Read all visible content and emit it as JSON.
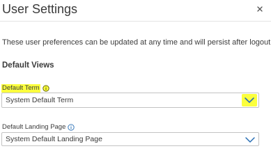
{
  "dialog": {
    "title": "User Settings",
    "close_icon": "close-icon",
    "description": "These user preferences can be updated at any time and will persist after logout."
  },
  "sections": {
    "default_views": {
      "heading": "Default Views",
      "default_term": {
        "label": "Default Term",
        "info_icon": "info-icon",
        "selected_value": "System Default Term",
        "highlighted": true,
        "highlight_color": "#fbff3d"
      },
      "default_landing_page": {
        "label": "Default Landing Page",
        "info_icon": "info-icon",
        "selected_value": "System Default Landing Page",
        "info_icon_color": "#2a6fb5"
      }
    }
  },
  "colors": {
    "chevron_blue": "#2a6fb5",
    "highlight": "#fbff3d"
  }
}
